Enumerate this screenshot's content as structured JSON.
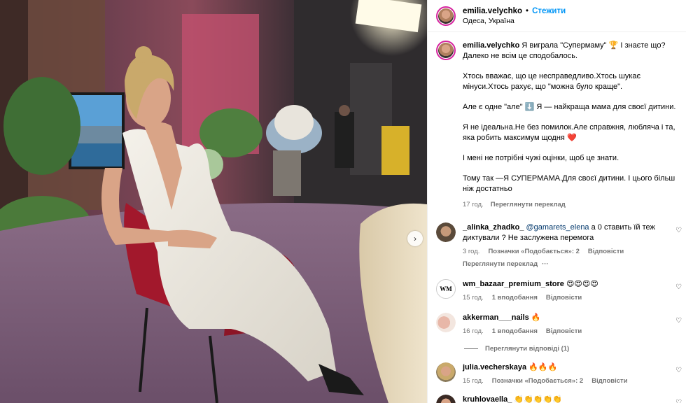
{
  "header": {
    "username": "emilia.velychko",
    "separator": "•",
    "follow_label": "Стежити",
    "location": "Одеса, Україна"
  },
  "caption": {
    "username": "emilia.velychko",
    "paragraphs": [
      "Я виграла \"Супермаму\" 🏆 І знаєте що? Далеко не всім це сподобалось.",
      "Хтось вважає, що це несправедливо.Хтось шукає мінуси.Хтось рахує, що \"можна було краще\".",
      "Але є одне \"але\" ⬇️ Я — найкраща мама для своєї дитини.",
      "Я не ідеальна.Не без помилок.Але справжня, любляча і та, яка робить максимум щодня ❤️",
      "І мені не потрібні чужі оцінки, щоб це знати.",
      "Тому так —Я СУПЕРМАМА.Для своєї дитини. І цього більш ніж достатньо"
    ],
    "time": "17 год.",
    "translate_label": "Переглянути переклад"
  },
  "comments": [
    {
      "username": "_alinka_zhadko_",
      "mention": "@gamarets_elena",
      "text": " а 0 ставить їй теж диктували ? Не заслужена перемога",
      "time": "3 год.",
      "likes": "Позначки «Подобається»: 2",
      "reply": "Відповісти",
      "translate": "Переглянути переклад",
      "more": "···"
    },
    {
      "username": "wm_bazaar_premium_store",
      "text": " 😍😍😍😍",
      "time": "15 год.",
      "likes": "1 вподобання",
      "reply": "Відповісти"
    },
    {
      "username": "akkerman___nails",
      "text": " 🔥",
      "time": "16 год.",
      "likes": "1 вподобання",
      "reply": "Відповісти",
      "view_replies": "Переглянути відповіді (1)"
    },
    {
      "username": "julia.vecherskaya",
      "text": " 🔥🔥🔥",
      "time": "15 год.",
      "likes": "Позначки «Подобається»: 2",
      "reply": "Відповісти"
    },
    {
      "username": "kruhlovaella_",
      "text": " 👏👏👏👏👏"
    }
  ],
  "icons": {
    "heart": "heart-icon",
    "next": "chevron-right-icon"
  },
  "colors": {
    "follow": "#0095f6",
    "meta": "#737373",
    "mention": "#00376b"
  }
}
